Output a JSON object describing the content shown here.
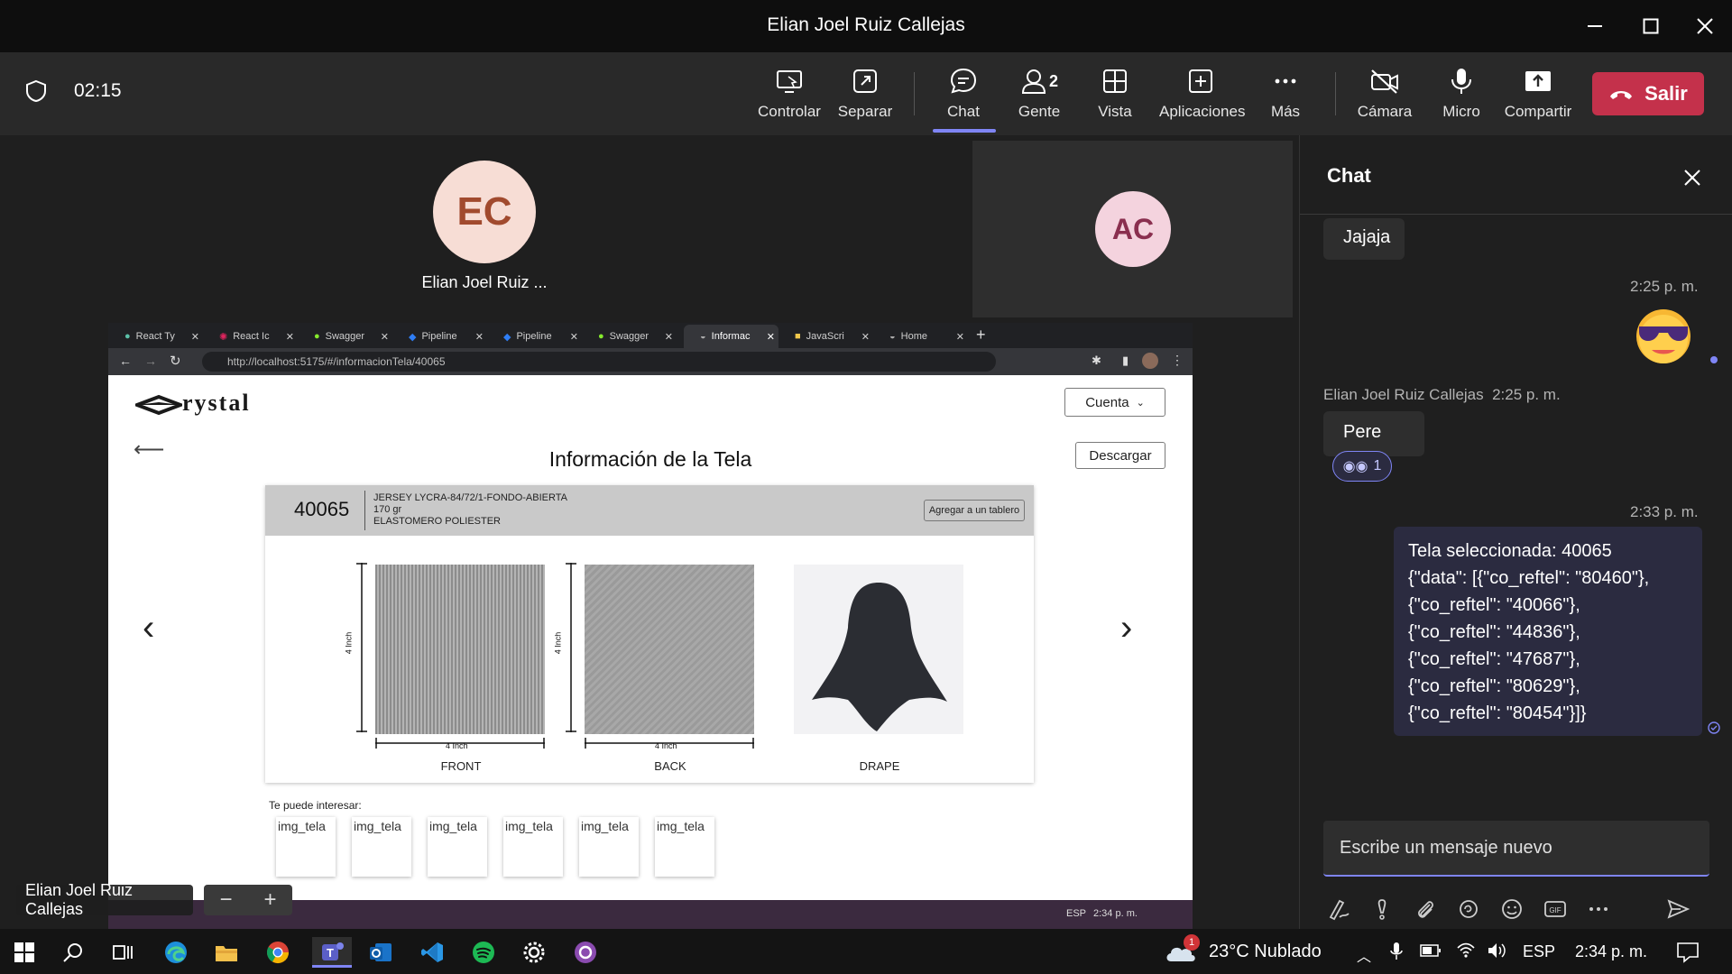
{
  "window": {
    "title": "Elian Joel Ruiz Callejas"
  },
  "meeting": {
    "timer": "02:15",
    "toolbar": {
      "controlar": "Controlar",
      "separar": "Separar",
      "chat": "Chat",
      "gente": "Gente",
      "gente_count": "2",
      "vista": "Vista",
      "aplicaciones": "Aplicaciones",
      "mas": "Más",
      "camara": "Cámara",
      "micro": "Micro",
      "compartir": "Compartir",
      "salir": "Salir"
    },
    "participants": [
      {
        "initials": "EC",
        "name": "Elian Joel Ruiz ..."
      },
      {
        "initials": "AC"
      }
    ],
    "presenter_label": "Elian Joel Ruiz Callejas"
  },
  "shared_screen": {
    "tabs": [
      "React Ty",
      "React Ic",
      "Swagger",
      "Pipeline",
      "Pipeline",
      "Swagger",
      "Informac",
      "JavaScri",
      "Home"
    ],
    "url": "http://localhost:5175/#/informacionTela/40065",
    "page": {
      "logo": "rystal",
      "account_button": "Cuenta",
      "title": "Información de la Tela",
      "download_button": "Descargar",
      "fabric": {
        "code": "40065",
        "line1": "JERSEY LYCRA-84/72/1-FONDO-ABIERTA",
        "line2": "170 gr",
        "line3": "ELASTOMERO POLIESTER",
        "add_board": "Agregar a un tablero"
      },
      "dimension_label": "4 Inch",
      "swatches": [
        "FRONT",
        "BACK",
        "DRAPE"
      ],
      "interest_title": "Te puede interesar:",
      "thumb_alt": "img_tela",
      "taskbar_lang": "ESP",
      "taskbar_time": "2:34 p. m."
    }
  },
  "chat": {
    "title": "Chat",
    "messages": {
      "m1": "Jajaja",
      "ts1": "2:25 p. m.",
      "sender2": "Elian Joel Ruiz Callejas",
      "ts2": "2:25 p. m.",
      "m2": "Pere",
      "reaction_count": "1",
      "ts3": "2:33 p. m.",
      "m3_lines": [
        "Tela seleccionada: 40065",
        "{\"data\": [{\"co_reftel\": \"80460\"},",
        "{\"co_reftel\": \"40066\"},",
        "{\"co_reftel\": \"44836\"},",
        "{\"co_reftel\": \"47687\"},",
        "{\"co_reftel\": \"80629\"},",
        "{\"co_reftel\": \"80454\"}]}"
      ]
    },
    "input_placeholder": "Escribe un mensaje nuevo"
  },
  "taskbar": {
    "badge": "1",
    "weather": "23°C  Nublado",
    "lang": "ESP",
    "time": "2:34 p. m."
  },
  "colors": {
    "accent": "#7f85f5",
    "leave": "#c4314b",
    "avatar_ec_bg": "#f7ddd5",
    "avatar_ec_fg": "#a14a2e",
    "avatar_ac_bg": "#f4d3de",
    "avatar_ac_fg": "#8a2f4f"
  }
}
